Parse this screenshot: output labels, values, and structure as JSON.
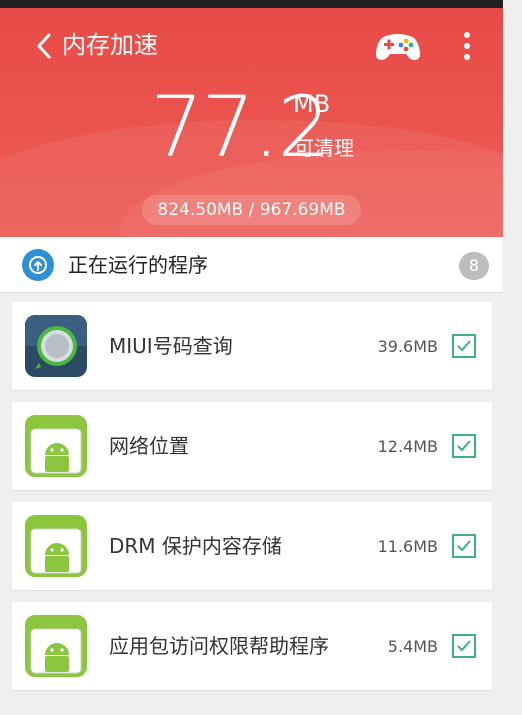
{
  "header": {
    "title": "内存加速",
    "icons": {
      "back": "back-arrow-icon",
      "game": "gamepad-icon",
      "more": "more-vertical-icon"
    },
    "cleanable_amount": "77.2",
    "unit": "MB",
    "cleanable_label": "可清理",
    "memory_usage": "824.50MB / 967.69MB",
    "colors": {
      "primary": "#e84a46",
      "accent_green": "#3bb37a"
    }
  },
  "section": {
    "title": "正在运行的程序",
    "count": "8",
    "icon": "running-apps-icon"
  },
  "apps": [
    {
      "name": "MIUI号码查询",
      "size": "39.6MB",
      "checked": true,
      "icon": "miui-lookup-icon"
    },
    {
      "name": "网络位置",
      "size": "12.4MB",
      "checked": true,
      "icon": "android-icon"
    },
    {
      "name": "DRM 保护内容存储",
      "size": "11.6MB",
      "checked": true,
      "icon": "android-icon"
    },
    {
      "name": "应用包访问权限帮助程序",
      "size": "5.4MB",
      "checked": true,
      "icon": "android-icon"
    }
  ]
}
